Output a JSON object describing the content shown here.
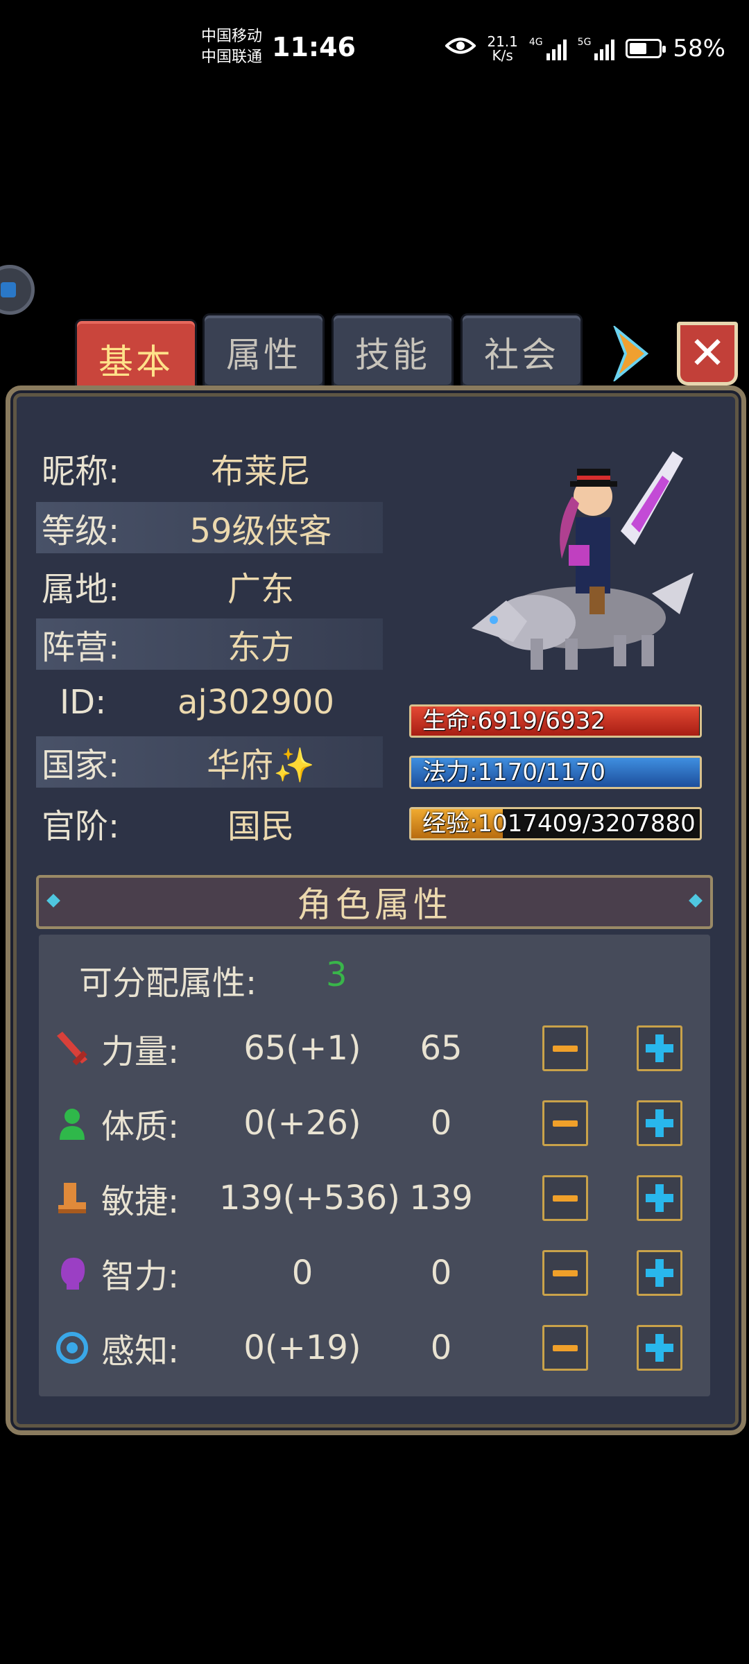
{
  "status_bar": {
    "carrier_1": "中国移动",
    "carrier_2": "中国联通",
    "time": "11:46",
    "net_speed_value": "21.1",
    "net_speed_unit": "K/s",
    "signal_1_label": "4G",
    "signal_2_label": "5G",
    "battery": "58%",
    "battery_level": 0.58
  },
  "tabs": [
    {
      "label": "基本",
      "active": true
    },
    {
      "label": "属性",
      "active": false
    },
    {
      "label": "技能",
      "active": false
    },
    {
      "label": "社会",
      "active": false
    }
  ],
  "close_label": "✕",
  "profile": [
    {
      "key": "昵称:",
      "value": "布莱尼"
    },
    {
      "key": "等级:",
      "value": "59级侠客"
    },
    {
      "key": "属地:",
      "value": "广东"
    },
    {
      "key": "阵营:",
      "value": "东方"
    },
    {
      "key": "ID:",
      "value": "aj302900"
    },
    {
      "key": "国家:",
      "value": "华府✨"
    },
    {
      "key": "官阶:",
      "value": "国民"
    }
  ],
  "bars": {
    "hp": {
      "text": "生命:6919/6932",
      "fraction": 0.998
    },
    "mp": {
      "text": "法力:1170/1170",
      "fraction": 1.0
    },
    "xp": {
      "text": "经验:1017409/3207880",
      "fraction": 0.317
    }
  },
  "attributes_section": {
    "title": "角色属性",
    "free_points_label": "可分配属性:",
    "free_points_value": "3",
    "rows": [
      {
        "name": "力量:",
        "base": "65(+1)",
        "current": "65",
        "icon": "sword-icon",
        "color": "#d8403a"
      },
      {
        "name": "体质:",
        "base": "0(+26)",
        "current": "0",
        "icon": "person-icon",
        "color": "#2fb84a"
      },
      {
        "name": "敏捷:",
        "base": "139(+536)",
        "current": "139",
        "icon": "boot-icon",
        "color": "#e08a3a"
      },
      {
        "name": "智力:",
        "base": "0",
        "current": "0",
        "icon": "head-icon",
        "color": "#9b3fc4"
      },
      {
        "name": "感知:",
        "base": "0(+19)",
        "current": "0",
        "icon": "eye-icon",
        "color": "#3aa8e8"
      }
    ]
  }
}
